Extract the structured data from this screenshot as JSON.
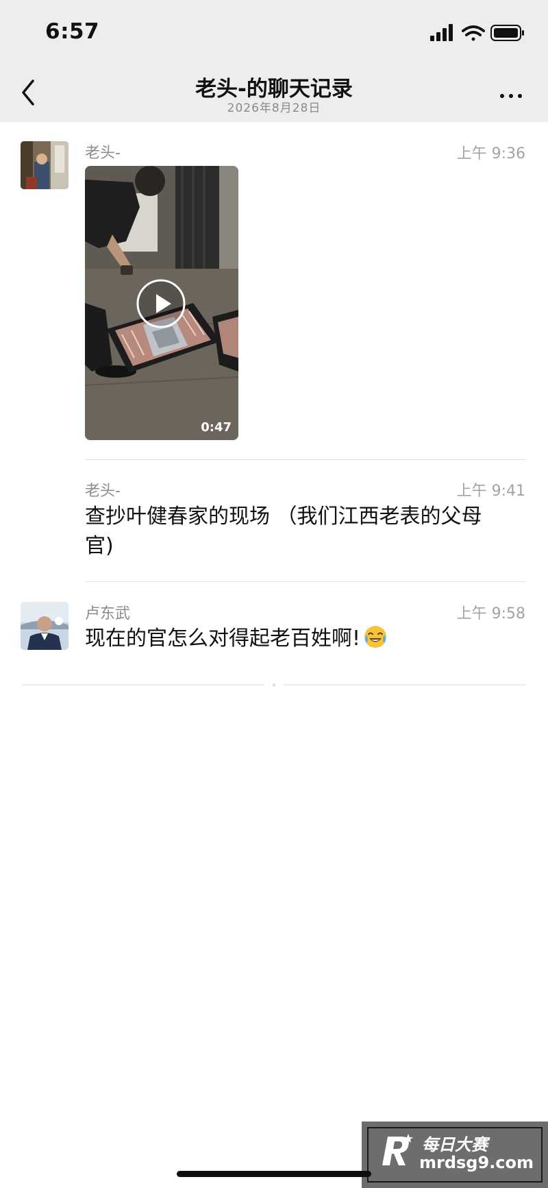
{
  "status_bar": {
    "time": "6:57",
    "icons": [
      "signal-icon",
      "wifi-icon",
      "battery-icon"
    ]
  },
  "nav": {
    "title": "老头-的聊天记录",
    "subtitle": "2026年8月28日",
    "back_icon": "chevron-left-icon",
    "more_icon": "more-icon"
  },
  "messages": [
    {
      "sender": "老头-",
      "time": "上午 9:36",
      "type": "video",
      "duration": "0:47"
    },
    {
      "sender": "老头-",
      "time": "上午 9:41",
      "type": "text",
      "text": "查抄叶健春家的现场 （我们江西老表的父母官)"
    },
    {
      "sender": "卢东武",
      "time": "上午 9:58",
      "type": "text",
      "text": "现在的官怎么对得起老百姓啊!",
      "emoji": "crying-laughing-emoji"
    }
  ],
  "watermark": {
    "name": "每日大赛",
    "url": "mrdsg9.com"
  },
  "colors": {
    "header_bg": "#ededed",
    "meta_text": "#8c8c8c",
    "divider": "#e2e2e2"
  }
}
